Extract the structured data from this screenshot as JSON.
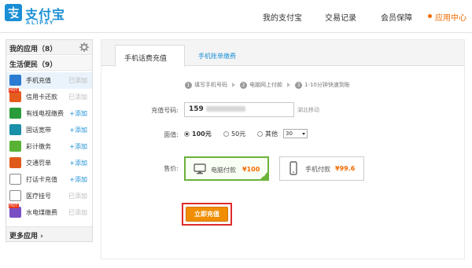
{
  "header": {
    "logo_cn": "支付宝",
    "logo_en": "ALIPAY",
    "nav": [
      {
        "label": "我的支付宝",
        "active": false
      },
      {
        "label": "交易记录",
        "active": false
      },
      {
        "label": "会员保障",
        "active": false
      },
      {
        "label": "应用中心",
        "active": true
      }
    ]
  },
  "sidebar": {
    "my_apps": "我的应用（8）",
    "life": "生活便民（9）",
    "more": "更多应用",
    "items": [
      {
        "label": "手机充值",
        "action": "已添加",
        "icon_color": "#2a7bd1",
        "icon": "phone-icon"
      },
      {
        "label": "信用卡还款",
        "action": "已添加",
        "icon_color": "#e65c1f",
        "icon": "creditcard-icon",
        "hot": "HOT"
      },
      {
        "label": "有线电视缴费",
        "action": "+添加",
        "icon_color": "#2a9b3a",
        "icon": "tv-icon"
      },
      {
        "label": "固话宽带",
        "action": "+添加",
        "icon_color": "#1a8fa8",
        "icon": "landline-icon"
      },
      {
        "label": "彩计缴务",
        "action": "+添加",
        "icon_color": "#58b236",
        "icon": "lottery-icon"
      },
      {
        "label": "交通罚单",
        "action": "+添加",
        "icon_color": "#e05a1a",
        "icon": "traffic-icon"
      },
      {
        "label": "打话卡充值",
        "action": "+添加",
        "icon_color": "#8a8a8a",
        "icon": "card-icon"
      },
      {
        "label": "医疗挂号",
        "action": "已添加",
        "icon_color": "#8a8a8a",
        "icon": "medical-icon"
      },
      {
        "label": "水电煤缴费",
        "action": "已添加",
        "icon_color": "#7a4fc4",
        "icon": "utility-icon",
        "hot": "HOT"
      }
    ]
  },
  "tabs": {
    "active": "手机话费充值",
    "other": "手机账单缴费"
  },
  "steps": [
    {
      "num": "1",
      "text": "填写手机号码"
    },
    {
      "num": "2",
      "text": "电脑网上付款"
    },
    {
      "num": "3",
      "text": "1-10分钟快速到账"
    }
  ],
  "form": {
    "phone_label": "充值号码:",
    "phone_value": "159",
    "phone_hint": "湖北移动",
    "amount_label": "面值:",
    "amounts": [
      {
        "label": "100元",
        "selected": true
      },
      {
        "label": "50元",
        "selected": false
      },
      {
        "label": "其他",
        "selected": false
      }
    ],
    "other_value": "30",
    "price_label": "售价:",
    "pay_options": [
      {
        "label": "电脑付款",
        "price": "¥100",
        "selected": true,
        "icon": "monitor-icon"
      },
      {
        "label": "手机付款",
        "price": "¥99.6",
        "selected": false,
        "icon": "mobile-icon"
      }
    ],
    "submit_label": "立即充值"
  }
}
